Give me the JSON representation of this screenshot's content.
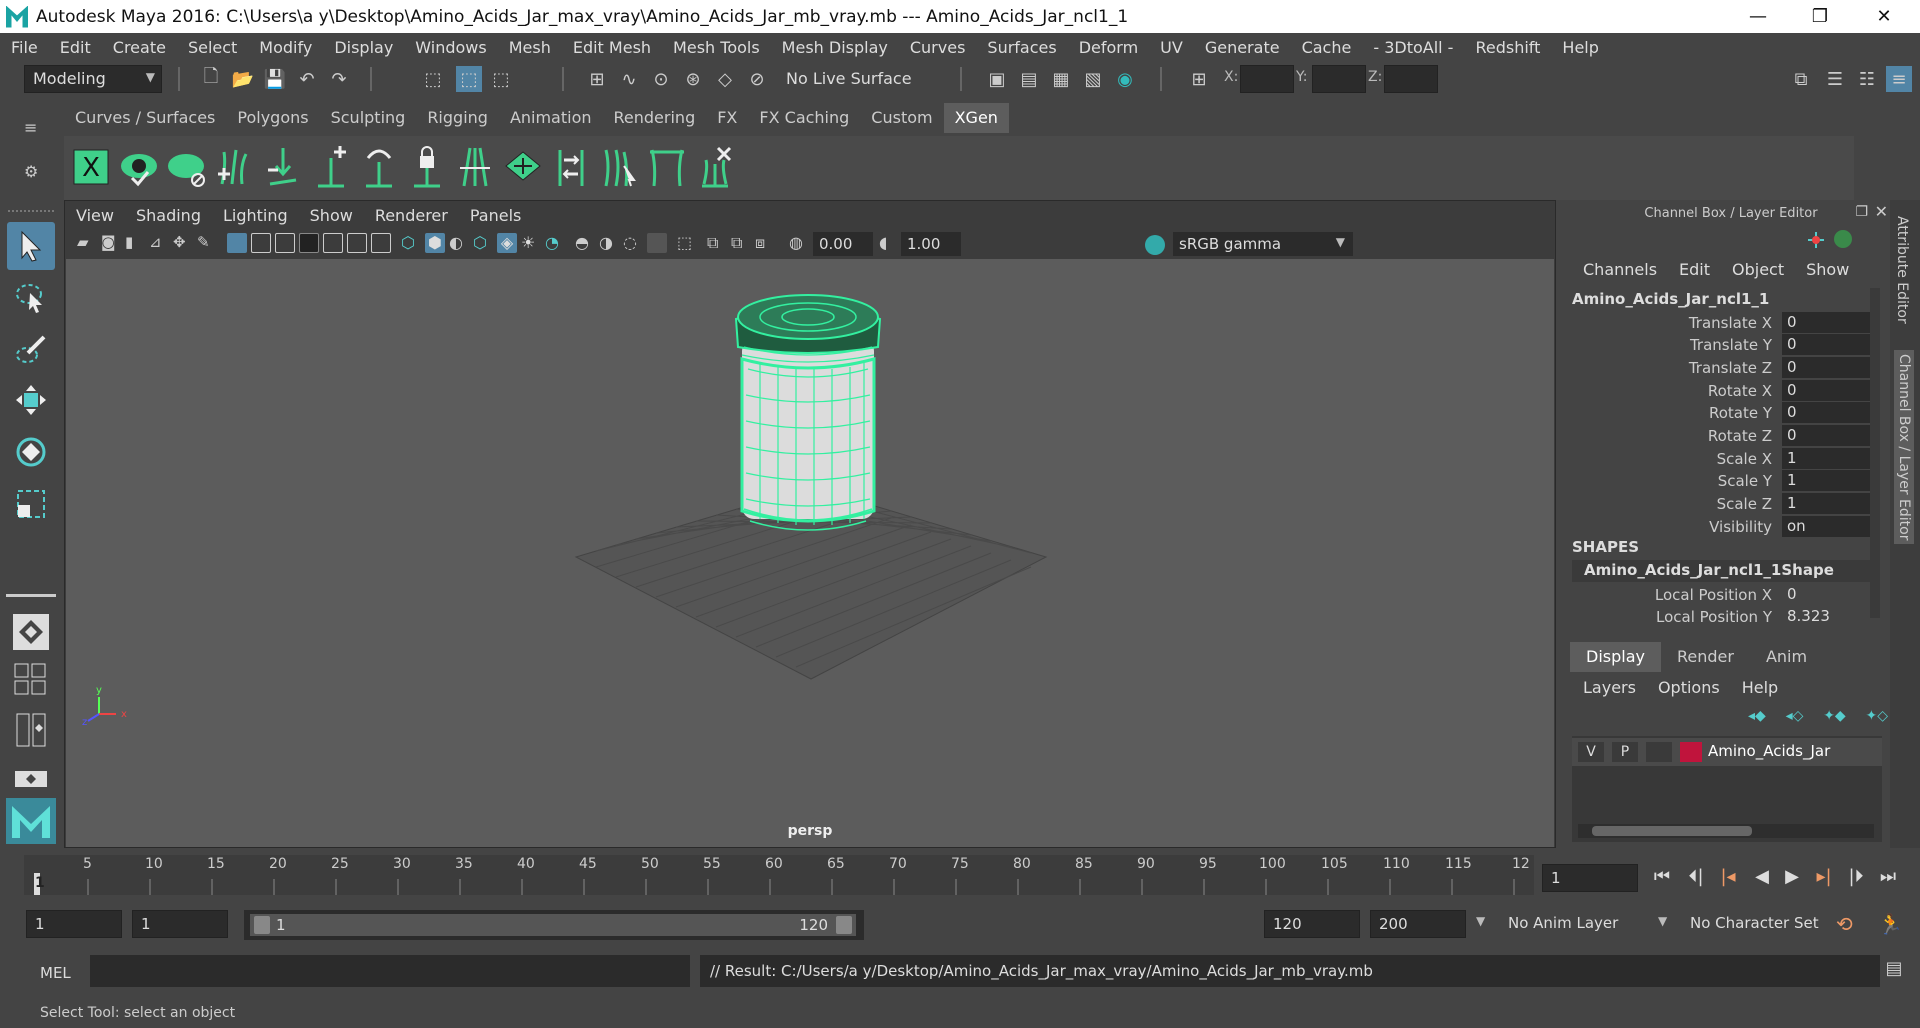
{
  "window": {
    "title": "Autodesk Maya 2016: C:\\Users\\a y\\Desktop\\Amino_Acids_Jar_max_vray\\Amino_Acids_Jar_mb_vray.mb   ---   Amino_Acids_Jar_ncl1_1",
    "minimize": "—",
    "maximize": "❐",
    "close": "✕"
  },
  "menus": [
    "File",
    "Edit",
    "Create",
    "Select",
    "Modify",
    "Display",
    "Windows",
    "Mesh",
    "Edit Mesh",
    "Mesh Tools",
    "Mesh Display",
    "Curves",
    "Surfaces",
    "Deform",
    "UV",
    "Generate",
    "Cache",
    "- 3DtoAll -",
    "Redshift",
    "Help"
  ],
  "status_line": {
    "mode": "Modeling",
    "live_surface": "No Live Surface",
    "x_label": "X:",
    "y_label": "Y:",
    "z_label": "Z:"
  },
  "shelf": {
    "tabs": [
      "Curves / Surfaces",
      "Polygons",
      "Sculpting",
      "Rigging",
      "Animation",
      "Rendering",
      "FX",
      "FX Caching",
      "Custom",
      "XGen"
    ],
    "active_tab": "XGen",
    "accent_color": "#3fd08a"
  },
  "viewport": {
    "menus": [
      "View",
      "Shading",
      "Lighting",
      "Show",
      "Renderer",
      "Panels"
    ],
    "exposure": "0.00",
    "gamma": "1.00",
    "color_space": "sRGB gamma",
    "camera_label": "persp",
    "wire_color": "#33f0a0"
  },
  "channel_box": {
    "title": "Channel Box / Layer Editor",
    "menus": [
      "Channels",
      "Edit",
      "Object",
      "Show"
    ],
    "object_name": "Amino_Acids_Jar_ncl1_1",
    "attributes": [
      {
        "label": "Translate X",
        "value": "0"
      },
      {
        "label": "Translate Y",
        "value": "0"
      },
      {
        "label": "Translate Z",
        "value": "0"
      },
      {
        "label": "Rotate X",
        "value": "0"
      },
      {
        "label": "Rotate Y",
        "value": "0"
      },
      {
        "label": "Rotate Z",
        "value": "0"
      },
      {
        "label": "Scale X",
        "value": "1"
      },
      {
        "label": "Scale Y",
        "value": "1"
      },
      {
        "label": "Scale Z",
        "value": "1"
      },
      {
        "label": "Visibility",
        "value": "on"
      }
    ],
    "shapes_header": "SHAPES",
    "shape_name": "Amino_Acids_Jar_ncl1_1Shape",
    "shape_attributes": [
      {
        "label": "Local Position X",
        "value": "0"
      },
      {
        "label": "Local Position Y",
        "value": "8.323"
      }
    ],
    "side_tabs": [
      "Attribute Editor",
      "Channel Box / Layer Editor"
    ]
  },
  "layer_editor": {
    "tabs": [
      "Display",
      "Render",
      "Anim"
    ],
    "active_tab": "Display",
    "menus": [
      "Layers",
      "Options",
      "Help"
    ],
    "layer": {
      "v": "V",
      "p": "P",
      "name": "Amino_Acids_Jar",
      "color": "#c0143c"
    }
  },
  "time_slider": {
    "ticks": [
      "5",
      "10",
      "15",
      "20",
      "25",
      "30",
      "35",
      "40",
      "45",
      "50",
      "55",
      "60",
      "65",
      "70",
      "75",
      "80",
      "85",
      "90",
      "95",
      "100",
      "105",
      "110",
      "115",
      "12"
    ],
    "current_frame_marker": "1",
    "current_frame": "1"
  },
  "range_slider": {
    "start": "1",
    "start_inner": "1",
    "handle_start": "1",
    "handle_end": "120",
    "end": "120",
    "total_end": "200",
    "anim_layer": "No Anim Layer",
    "character_set": "No Character Set"
  },
  "command_line": {
    "mode": "MEL",
    "result": "// Result: C:/Users/a y/Desktop/Amino_Acids_Jar_max_vray/Amino_Acids_Jar_mb_vray.mb"
  },
  "help_line": "Select Tool: select an object"
}
